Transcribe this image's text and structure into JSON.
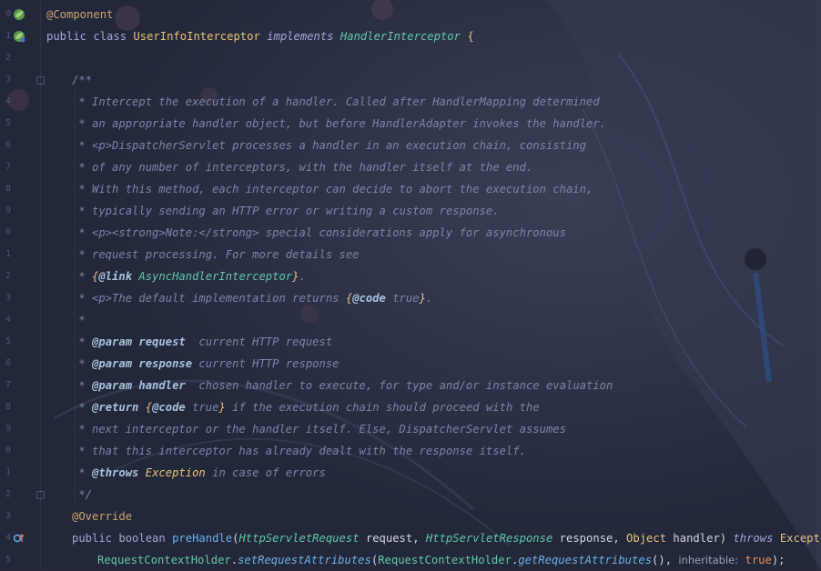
{
  "gutter": {
    "line_numbers": [
      "0",
      "1",
      "2",
      "3",
      "4",
      "5",
      "6",
      "7",
      "8",
      "9",
      "0",
      "1",
      "2",
      "3",
      "4",
      "5",
      "6",
      "7",
      "8",
      "9",
      "0",
      "1",
      "2",
      "3",
      "4",
      "5"
    ]
  },
  "code": {
    "l1_annotation": "@Component",
    "l2_public": "public",
    "l2_class": "class",
    "l2_classname": "UserInfoInterceptor",
    "l2_implements": "implements",
    "l2_iface": "HandlerInterceptor",
    "l2_brace": "{",
    "l4": "/**",
    "l5": " * Intercept the execution of a handler. Called after HandlerMapping determined",
    "l6": " * an appropriate handler object, but before HandlerAdapter invokes the handler.",
    "l7": " * <p>DispatcherServlet processes a handler in an execution chain, consisting",
    "l8": " * of any number of interceptors, with the handler itself at the end.",
    "l9": " * With this method, each interceptor can decide to abort the execution chain,",
    "l10": " * typically sending an HTTP error or writing a custom response.",
    "l11": " * <p><strong>Note:</strong> special considerations apply for asynchronous",
    "l12": " * request processing. For more details see",
    "l13_star": " * ",
    "l13_open": "{",
    "l13_tag": "@link",
    "l13_link": " AsyncHandlerInterceptor",
    "l13_close": "}",
    "l13_end": ".",
    "l14_text": " * <p>The default implementation returns ",
    "l14_open": "{",
    "l14_tag": "@code",
    "l14_val": " true",
    "l14_close": "}",
    "l14_end": ".",
    "l15": " *",
    "l16_star": " * ",
    "l16_tag": "@param",
    "l16_name": " request",
    "l16_desc": "  current HTTP request",
    "l17_star": " * ",
    "l17_tag": "@param",
    "l17_name": " response",
    "l17_desc": " current HTTP response",
    "l18_star": " * ",
    "l18_tag": "@param",
    "l18_name": " handler",
    "l18_desc": "  chosen handler to execute, for type and/or instance evaluation",
    "l19_star": " * ",
    "l19_tag": "@return",
    "l19_sp": " ",
    "l19_open": "{",
    "l19_code": "@code",
    "l19_val": " true",
    "l19_close": "}",
    "l19_desc": " if the execution chain should proceed with the",
    "l20": " * next interceptor or the handler itself. Else, DispatcherServlet assumes",
    "l21": " * that this interceptor has already dealt with the response itself.",
    "l22_star": " * ",
    "l22_tag": "@throws",
    "l22_exc": " Exception",
    "l22_desc": " in case of errors",
    "l23": " */",
    "l24": "@Override",
    "l25_public": "public",
    "l25_boolean": " boolean",
    "l25_fn": " preHandle",
    "l25_p1": "(",
    "l25_t1": "HttpServletRequest",
    "l25_n1": " request, ",
    "l25_t2": "HttpServletResponse",
    "l25_n2": " response, ",
    "l25_t3": "Object",
    "l25_n3": " handler) ",
    "l25_throws": "throws",
    "l25_exc": " Exception",
    "l25_brace": " {",
    "l26_cls": "RequestContextHolder",
    "l26_dot": ".",
    "l26_fn": "setRequestAttributes",
    "l26_p": "(",
    "l26_cls2": "RequestContextHolder",
    "l26_dot2": ".",
    "l26_fn2": "getRequestAttributes",
    "l26_p2": "(),",
    "l26_hint": "  inheritable:",
    "l26_true": " true",
    "l26_end": ");"
  },
  "icons": {
    "spring_bean": "spring-bean-icon",
    "override": "override-gutter-icon"
  },
  "colors": {
    "background": "#262a3b",
    "comment": "#7c85a8",
    "annotation": "#cba570",
    "keyword": "#a1a8d6",
    "class": "#e8c37a",
    "interface": "#5fc9a6",
    "method": "#6bb1e8"
  }
}
